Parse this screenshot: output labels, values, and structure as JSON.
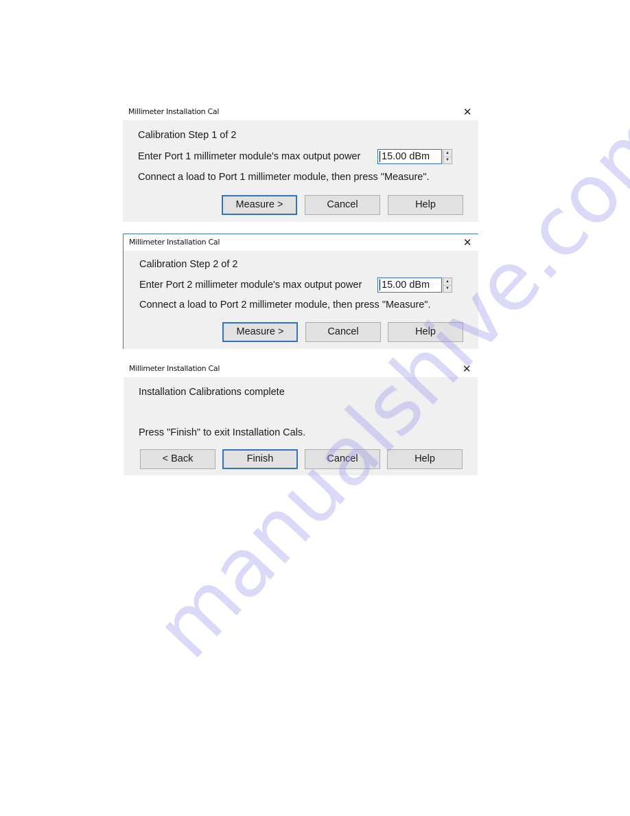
{
  "dialogs": [
    {
      "title": "Millimeter Installation Cal",
      "close_glyph": "✕",
      "heading": "Calibration Step 1 of 2",
      "prompt": "Enter Port 1 millimeter module's max output power",
      "power_value": "15.00 dBm",
      "instruction": "Connect a load to Port 1 millimeter module, then press \"Measure\".",
      "buttons": {
        "measure": "Measure >",
        "cancel": "Cancel",
        "help": "Help"
      }
    },
    {
      "title": "Millimeter Installation Cal",
      "close_glyph": "✕",
      "heading": "Calibration Step 2 of 2",
      "prompt": "Enter Port 2 millimeter module's max output power",
      "power_value": "15.00 dBm",
      "instruction": "Connect a load to Port 2 millimeter module, then press \"Measure\".",
      "buttons": {
        "measure": "Measure >",
        "cancel": "Cancel",
        "help": "Help"
      }
    },
    {
      "title": "Millimeter Installation Cal",
      "close_glyph": "✕",
      "heading": "Installation Calibrations complete",
      "instruction": "Press \"Finish\" to exit Installation Cals.",
      "buttons": {
        "back": "< Back",
        "finish": "Finish",
        "cancel": "Cancel",
        "help": "Help"
      }
    }
  ],
  "spinner": {
    "up_glyph": "▲",
    "down_glyph": "▼"
  },
  "watermark": "manualshive.com"
}
